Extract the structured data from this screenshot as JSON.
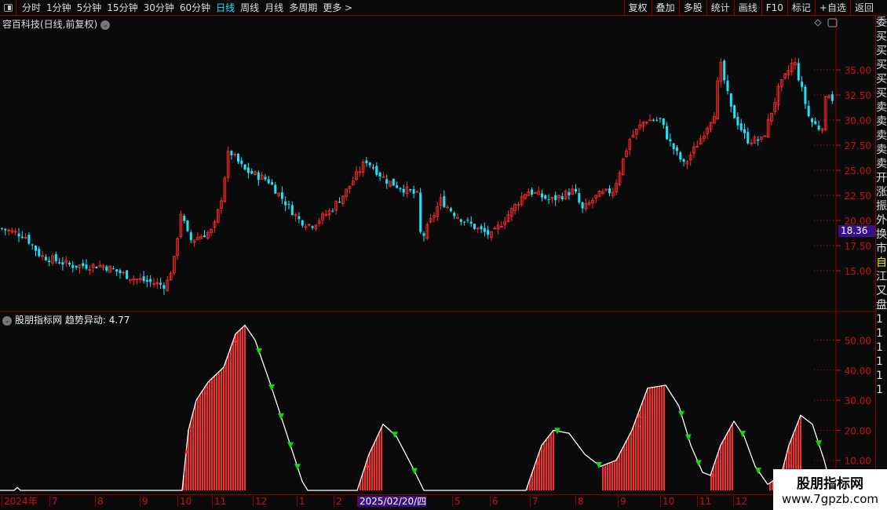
{
  "toolbar": {
    "periods": [
      "分时",
      "1分钟",
      "5分钟",
      "15分钟",
      "30分钟",
      "60分钟",
      "日线",
      "周线",
      "月线",
      "多周期",
      "更多 >"
    ],
    "active": "日线",
    "buttons": [
      "复权",
      "叠加",
      "多股",
      "统计",
      "画线",
      "F10",
      "标记",
      "+自选",
      "返回"
    ]
  },
  "stock": {
    "title": "容百科技(日线,前复权)",
    "last_price": "18.36"
  },
  "price_axis": [
    "35.00",
    "32.50",
    "30.00",
    "27.50",
    "25.00",
    "22.50",
    "20.00",
    "17.50",
    "15.00"
  ],
  "indicator": {
    "title": "股朋指标网",
    "name": "趋势异动",
    "value": ": 4.77",
    "axis": [
      "50.00",
      "40.00",
      "30.00",
      "20.00",
      "10.00"
    ]
  },
  "time_axis": [
    "2024年",
    "7",
    "8",
    "9",
    "10",
    "11",
    "12",
    "1",
    "2",
    "2025/02/20/四",
    "5",
    "6",
    "7",
    "8",
    "9",
    "10",
    "11",
    "12"
  ],
  "right_strip": [
    "委",
    "买",
    "买",
    "买",
    "买",
    "买",
    "卖",
    "卖",
    "卖",
    "卖",
    "卖",
    "开",
    "涨",
    "振",
    "外",
    "换",
    "市",
    "自",
    "江",
    "又",
    "盘",
    "1",
    "1",
    "1",
    "1",
    "1",
    "1"
  ],
  "watermark": {
    "name": "股朋指标网",
    "url": "www.7gpzb.com"
  },
  "colors": {
    "up": "#ff2a2a",
    "down": "#19e5ff",
    "axis": "#d01010",
    "border": "#8b0000",
    "arrow": "#12d812"
  },
  "chart_data": {
    "type": "candlestick+indicator",
    "price_path": [
      [
        0,
        19.2
      ],
      [
        30,
        18.5
      ],
      [
        50,
        16.5
      ],
      [
        90,
        15.5
      ],
      [
        130,
        15.5
      ],
      [
        170,
        14.2
      ],
      [
        210,
        13.5
      ],
      [
        222,
        16.5
      ],
      [
        228,
        21
      ],
      [
        240,
        18
      ],
      [
        270,
        19
      ],
      [
        280,
        22
      ],
      [
        290,
        27
      ],
      [
        310,
        25
      ],
      [
        340,
        24
      ],
      [
        380,
        20
      ],
      [
        395,
        19.5
      ],
      [
        420,
        21
      ],
      [
        440,
        23
      ],
      [
        465,
        26
      ],
      [
        490,
        24
      ],
      [
        530,
        22.5
      ],
      [
        535,
        18
      ],
      [
        560,
        22
      ],
      [
        580,
        20.5
      ],
      [
        610,
        19
      ],
      [
        625,
        18.5
      ],
      [
        650,
        21
      ],
      [
        670,
        23
      ],
      [
        700,
        22
      ],
      [
        730,
        23
      ],
      [
        740,
        21
      ],
      [
        760,
        22.5
      ],
      [
        780,
        23
      ],
      [
        800,
        28
      ],
      [
        820,
        30
      ],
      [
        840,
        30
      ],
      [
        850,
        28
      ],
      [
        870,
        25.5
      ],
      [
        890,
        28
      ],
      [
        910,
        31
      ],
      [
        915,
        36
      ],
      [
        930,
        31
      ],
      [
        950,
        28
      ],
      [
        970,
        28
      ],
      [
        990,
        33
      ],
      [
        1010,
        36
      ],
      [
        1030,
        30
      ],
      [
        1045,
        29
      ],
      [
        1052,
        33
      ],
      [
        1060,
        32
      ]
    ],
    "indicator_path": [
      [
        0,
        0
      ],
      [
        18,
        0
      ],
      [
        22,
        1
      ],
      [
        26,
        0
      ],
      [
        232,
        0
      ],
      [
        240,
        20
      ],
      [
        250,
        30
      ],
      [
        265,
        36
      ],
      [
        285,
        41
      ],
      [
        300,
        52
      ],
      [
        312,
        55
      ],
      [
        325,
        50
      ],
      [
        345,
        35
      ],
      [
        370,
        15
      ],
      [
        385,
        3
      ],
      [
        392,
        0
      ],
      [
        455,
        0
      ],
      [
        470,
        12
      ],
      [
        488,
        22
      ],
      [
        505,
        18
      ],
      [
        525,
        8
      ],
      [
        540,
        0
      ],
      [
        670,
        0
      ],
      [
        690,
        15
      ],
      [
        705,
        20
      ],
      [
        725,
        19
      ],
      [
        745,
        12
      ],
      [
        765,
        8
      ],
      [
        785,
        10
      ],
      [
        805,
        20
      ],
      [
        825,
        34
      ],
      [
        848,
        35
      ],
      [
        865,
        28
      ],
      [
        880,
        15
      ],
      [
        895,
        6
      ],
      [
        905,
        5
      ],
      [
        918,
        15
      ],
      [
        935,
        23
      ],
      [
        948,
        18
      ],
      [
        962,
        8
      ],
      [
        978,
        2
      ],
      [
        995,
        5
      ],
      [
        1005,
        15
      ],
      [
        1020,
        25
      ],
      [
        1035,
        22
      ],
      [
        1050,
        10
      ],
      [
        1058,
        2
      ]
    ],
    "price_range": [
      12.5,
      38
    ],
    "indicator_range": [
      0,
      60
    ]
  }
}
